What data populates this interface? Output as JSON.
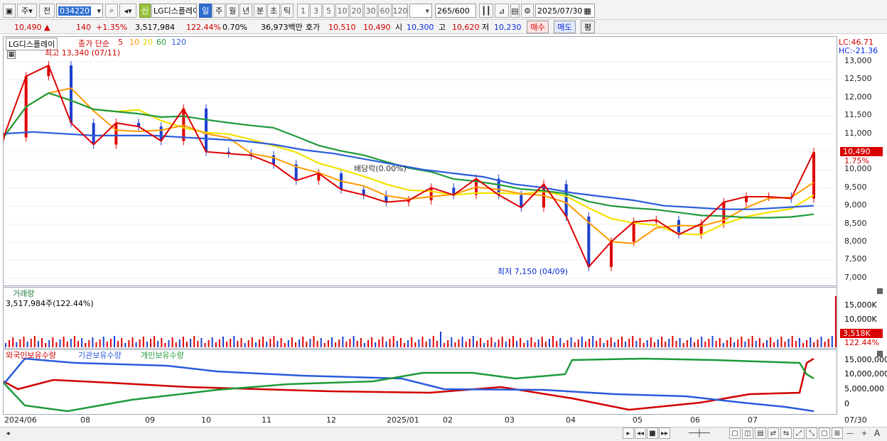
{
  "toolbar": {
    "mode_label": "주",
    "prev_label": "전",
    "code": "034220",
    "name": "LG디스플레이",
    "badge_new": "신",
    "periods": [
      "일",
      "주",
      "월",
      "년",
      "분",
      "초",
      "틱"
    ],
    "active_period": "일",
    "intervals": [
      "1",
      "3",
      "5",
      "10",
      "20",
      "30",
      "60",
      "120"
    ],
    "count": "265",
    "count_max": "/600",
    "date": "2025/07/30"
  },
  "quote": {
    "price": "10,490",
    "arrow": "▲",
    "change": "140",
    "change_pct": "+1.35%",
    "volume": "3,517,984",
    "vol_ratio": "122.44%",
    "turnover_pct": "0.70%",
    "amount": "36,973백만",
    "bid_label": "호가",
    "bid": "10,510",
    "ask": "10,490",
    "open_label": "시",
    "open": "10,300",
    "high_label": "고",
    "high": "10,620",
    "low_label": "저",
    "low": "10,230",
    "buy_label": "매수",
    "sell_label": "매도",
    "flat_label": "평"
  },
  "price_panel": {
    "name_tag": "LG디스플레이",
    "ma_title": "종가 단순",
    "ma_periods": [
      "5",
      "10",
      "20",
      "60",
      "120"
    ],
    "ma_colors": [
      "#e00000",
      "#ff9a00",
      "#f5e100",
      "#1e9a3a",
      "#2a5bdc"
    ],
    "high_note": "최고 13,340 (07/11)",
    "low_note": "최저 7,150 (04/09)",
    "dividend_note": "배당락(0.00%)",
    "lc": "LC:46.71",
    "hc": "HC:-21.36",
    "price_badge": "10,490",
    "change_badge": "1.75%",
    "y_ticks": [
      "13,000",
      "12,500",
      "12,000",
      "11,500",
      "11,000",
      "10,500",
      "10,000",
      "9,500",
      "9,000",
      "8,500",
      "8,000",
      "7,500",
      "7,000"
    ]
  },
  "volume_panel": {
    "title": "거래량",
    "value": "3,517,984주(122.44%)",
    "y_ticks": [
      "15,000K",
      "10,000K",
      "5,000K"
    ],
    "badge": "3,518K",
    "badge_pct": "122.44%"
  },
  "holding_panel": {
    "legend": [
      "외국인보유수량",
      "기관보유수량",
      "개인보유수량"
    ],
    "legend_colors": [
      "#d10000",
      "#2a5bdc",
      "#1e9a3a"
    ],
    "y_ticks": [
      "15,000,000",
      "10,000,000",
      "5,000,000",
      "0"
    ]
  },
  "x_axis": [
    "2024/06",
    "08",
    "09",
    "10",
    "11",
    "12",
    "2025/01",
    "02",
    "03",
    "04",
    "05",
    "06",
    "07"
  ],
  "x_axis_end": "07/30",
  "chart_data": {
    "type": "line",
    "series": [
      {
        "name": "종가",
        "values": [
          10900,
          12600,
          12900,
          11300,
          10700,
          11300,
          11200,
          10800,
          11700,
          10500,
          10450,
          10400,
          10150,
          9700,
          9900,
          9450,
          9300,
          9100,
          9150,
          9500,
          9300,
          9750,
          9300,
          8950,
          9600,
          8700,
          7300,
          8000,
          8550,
          8600,
          8200,
          8500,
          9100,
          9250,
          9250,
          9200,
          10490
        ]
      },
      {
        "name": "120",
        "values": [
          11000,
          11050,
          11000,
          10950,
          10950,
          10950,
          10900,
          10850,
          10800,
          10700,
          10550,
          10450,
          10300,
          10150,
          10000,
          9900,
          9800,
          9600,
          9500,
          9350,
          9250,
          9150,
          9000,
          8950,
          8900,
          8900,
          8950,
          9000
        ]
      }
    ]
  }
}
